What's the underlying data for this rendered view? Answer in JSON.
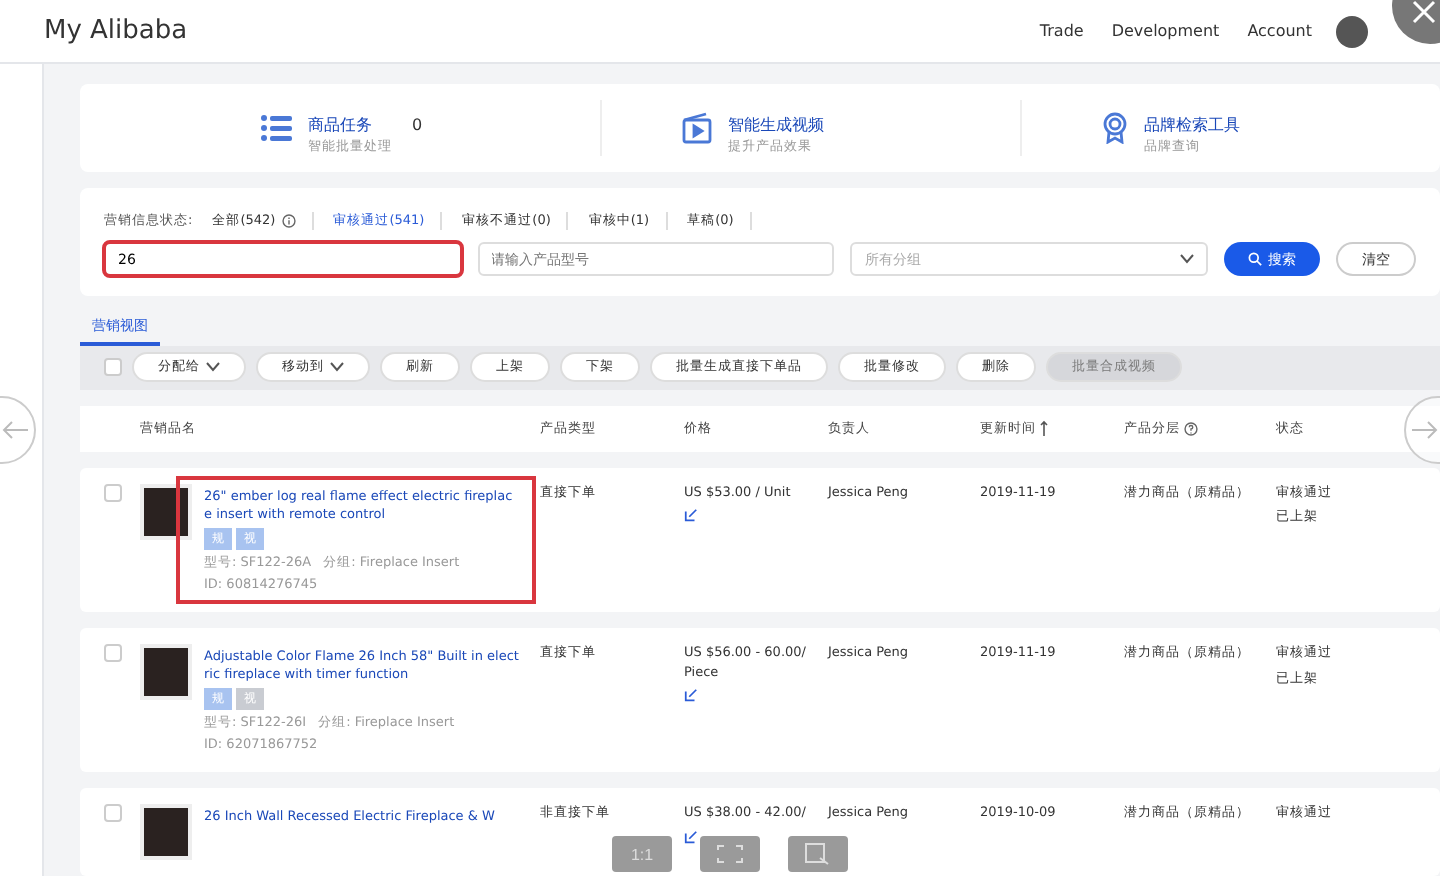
{
  "header": {
    "title": "My Alibaba",
    "nav": [
      "Trade",
      "Development",
      "Account"
    ]
  },
  "features": [
    {
      "title": "商品任务",
      "count": "0",
      "subtitle": "智能批量处理"
    },
    {
      "title": "智能生成视频",
      "subtitle": "提升产品效果"
    },
    {
      "title": "品牌检索工具",
      "subtitle": "品牌查询"
    }
  ],
  "filter": {
    "label": "营销信息状态:",
    "statuses": [
      {
        "label": "全部(542)",
        "selected": false,
        "info": true
      },
      {
        "label": "审核通过(541)",
        "selected": true,
        "info": false
      },
      {
        "label": "审核不通过(0)",
        "selected": false,
        "info": false
      },
      {
        "label": "审核中(1)",
        "selected": false,
        "info": false
      },
      {
        "label": "草稿(0)",
        "selected": false,
        "info": false
      }
    ],
    "keyword": {
      "value": "26",
      "highlighted": true
    },
    "model": {
      "placeholder": "请输入产品型号"
    },
    "group": {
      "placeholder": "所有分组"
    },
    "search_button": "搜索",
    "clear_button": "清空"
  },
  "tabs": [
    {
      "label": "营销视图",
      "selected": true
    }
  ],
  "select_all": {
    "checked": false
  },
  "toolbar": [
    {
      "label": "分配给",
      "dropdown": true,
      "disabled": false
    },
    {
      "label": "移动到",
      "dropdown": true,
      "disabled": false
    },
    {
      "label": "刷新",
      "dropdown": false,
      "disabled": false
    },
    {
      "label": "上架",
      "dropdown": false,
      "disabled": false
    },
    {
      "label": "下架",
      "dropdown": false,
      "disabled": false
    },
    {
      "label": "批量生成直接下单品",
      "dropdown": false,
      "disabled": false
    },
    {
      "label": "批量修改",
      "dropdown": false,
      "disabled": false
    },
    {
      "label": "删除",
      "dropdown": false,
      "disabled": false
    },
    {
      "label": "批量合成视频",
      "dropdown": false,
      "disabled": true
    }
  ],
  "table": {
    "columns": [
      {
        "label": "营销品名",
        "kind": "plain"
      },
      {
        "label": "产品类型",
        "kind": "plain"
      },
      {
        "label": "价格",
        "kind": "plain"
      },
      {
        "label": "负责人",
        "kind": "plain"
      },
      {
        "label": "更新时间",
        "kind": "sortable"
      },
      {
        "label": "产品分层",
        "kind": "help"
      },
      {
        "label": "状态",
        "kind": "plain"
      }
    ],
    "rows": [
      {
        "title": "26\" ember log real flame effect electric fireplace insert with remote control",
        "tags": [
          {
            "label": "规",
            "active": true
          },
          {
            "label": "视",
            "active": true
          }
        ],
        "model": "型号: SF122-26A",
        "group": "分组: Fireplace Insert",
        "id": "ID: 60814276745",
        "type": "直接下单",
        "price": "US $53.00 / Unit",
        "owner": "Jessica Peng",
        "updated": "2019-11-19",
        "tier": "潜力商品（原精品）",
        "status": [
          "审核通过",
          "已上架"
        ],
        "highlighted": true,
        "checked": false
      },
      {
        "title": "Adjustable Color Flame 26 Inch 58\" Built in electric fireplace with timer function",
        "tags": [
          {
            "label": "规",
            "active": true
          },
          {
            "label": "视",
            "active": false
          }
        ],
        "model": "型号: SF122-26I",
        "group": "分组: Fireplace Insert",
        "id": "ID: 62071867752",
        "type": "直接下单",
        "price": "US $56.00 - 60.00/ Piece",
        "owner": "Jessica Peng",
        "updated": "2019-11-19",
        "tier": "潜力商品（原精品）",
        "status": [
          "审核通过",
          "已上架"
        ],
        "highlighted": false,
        "checked": false
      },
      {
        "title": "26 Inch Wall Recessed Electric Fireplace & W",
        "tags": [],
        "type": "非直接下单",
        "price": "US $38.00 - 42.00/",
        "owner": "Jessica Peng",
        "updated": "2019-10-09",
        "tier": "潜力商品（原精品）",
        "status": [
          "审核通过"
        ],
        "highlighted": false,
        "checked": false
      }
    ]
  },
  "viewer_controls": [
    {
      "kind": "text",
      "label": "1:1"
    },
    {
      "kind": "fit"
    },
    {
      "kind": "export"
    }
  ]
}
